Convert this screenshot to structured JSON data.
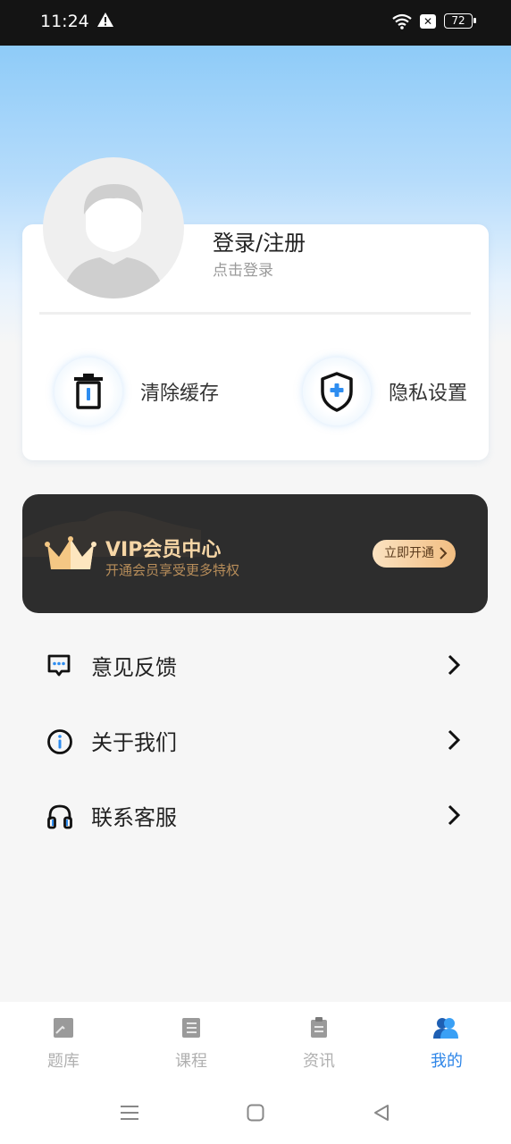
{
  "status_bar": {
    "time": "11:24",
    "battery": "72"
  },
  "profile": {
    "title": "登录/注册",
    "subtitle": "点击登录"
  },
  "actions": [
    {
      "label": "清除缓存",
      "icon": "trash-icon"
    },
    {
      "label": "隐私设置",
      "icon": "shield-icon"
    }
  ],
  "vip": {
    "title": "VIP会员中心",
    "subtitle": "开通会员享受更多特权",
    "button": "立即开通"
  },
  "menu": [
    {
      "label": "意见反馈",
      "icon": "feedback-icon"
    },
    {
      "label": "关于我们",
      "icon": "info-icon"
    },
    {
      "label": "联系客服",
      "icon": "headset-icon"
    }
  ],
  "tabs": [
    {
      "label": "题库",
      "icon": "question-bank-icon",
      "active": false
    },
    {
      "label": "课程",
      "icon": "course-icon",
      "active": false
    },
    {
      "label": "资讯",
      "icon": "news-icon",
      "active": false
    },
    {
      "label": "我的",
      "icon": "profile-icon",
      "active": true
    }
  ],
  "colors": {
    "accent": "#2e86e8",
    "vip_gold": "#f6d6a6",
    "vip_bg": "#2d2d2d"
  }
}
